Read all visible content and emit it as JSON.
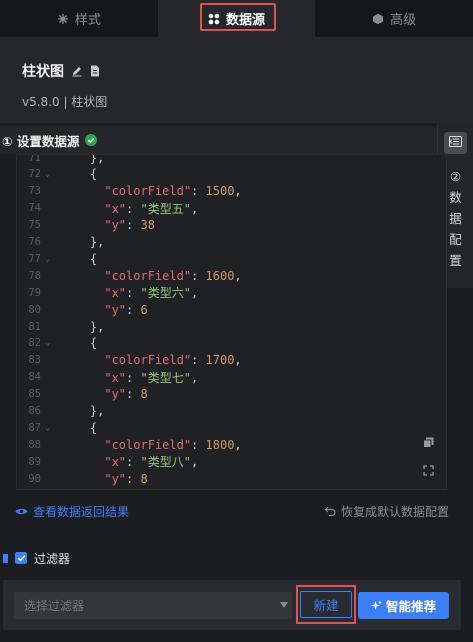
{
  "tabs": [
    {
      "label": "样式",
      "icon": "palette-icon"
    },
    {
      "label": "数据源",
      "icon": "datasource-icon"
    },
    {
      "label": "高级",
      "icon": "cube-icon"
    }
  ],
  "header": {
    "title": "柱状图",
    "version": "v5.8.0 | 柱状图"
  },
  "section": {
    "title": "① 设置数据源"
  },
  "side_panel": {
    "label": [
      "②",
      "数",
      "据",
      "配",
      "置"
    ]
  },
  "editor": {
    "lines": [
      {
        "n": "71",
        "fold": "",
        "code": "    },"
      },
      {
        "n": "72",
        "fold": "⌄",
        "code": "    {"
      },
      {
        "n": "73",
        "fold": "",
        "key": "\"colorField\"",
        "val": "1500",
        "type": "n",
        "trail": ","
      },
      {
        "n": "74",
        "fold": "",
        "key": "\"x\"",
        "val": "\"类型五\"",
        "type": "s",
        "trail": ","
      },
      {
        "n": "75",
        "fold": "",
        "key": "\"y\"",
        "val": "38",
        "type": "n",
        "trail": ""
      },
      {
        "n": "76",
        "fold": "",
        "code": "    },"
      },
      {
        "n": "77",
        "fold": "⌄",
        "code": "    {"
      },
      {
        "n": "78",
        "fold": "",
        "key": "\"colorField\"",
        "val": "1600",
        "type": "n",
        "trail": ","
      },
      {
        "n": "79",
        "fold": "",
        "key": "\"x\"",
        "val": "\"类型六\"",
        "type": "s",
        "trail": ","
      },
      {
        "n": "80",
        "fold": "",
        "key": "\"y\"",
        "val": "6",
        "type": "n",
        "trail": ""
      },
      {
        "n": "81",
        "fold": "",
        "code": "    },"
      },
      {
        "n": "82",
        "fold": "⌄",
        "code": "    {"
      },
      {
        "n": "83",
        "fold": "",
        "key": "\"colorField\"",
        "val": "1700",
        "type": "n",
        "trail": ","
      },
      {
        "n": "84",
        "fold": "",
        "key": "\"x\"",
        "val": "\"类型七\"",
        "type": "s",
        "trail": ","
      },
      {
        "n": "85",
        "fold": "",
        "key": "\"y\"",
        "val": "8",
        "type": "n",
        "trail": ""
      },
      {
        "n": "86",
        "fold": "",
        "code": "    },"
      },
      {
        "n": "87",
        "fold": "⌄",
        "code": "    {"
      },
      {
        "n": "88",
        "fold": "",
        "key": "\"colorField\"",
        "val": "1800",
        "type": "n",
        "trail": ","
      },
      {
        "n": "89",
        "fold": "",
        "key": "\"x\"",
        "val": "\"类型八\"",
        "type": "s",
        "trail": ","
      },
      {
        "n": "90",
        "fold": "",
        "key": "\"y\"",
        "val": "8",
        "type": "n",
        "trail": ""
      }
    ]
  },
  "links": {
    "view_result": "查看数据返回结果",
    "reset_default": "恢复成默认数据配置"
  },
  "filter": {
    "label": "过滤器",
    "checked": true,
    "select_placeholder": "选择过滤器",
    "new_button": "新建",
    "ai_button": "智能推荐"
  },
  "colors": {
    "accent": "#3b7ef6",
    "highlight": "#e25152",
    "success": "#2ea44f"
  }
}
